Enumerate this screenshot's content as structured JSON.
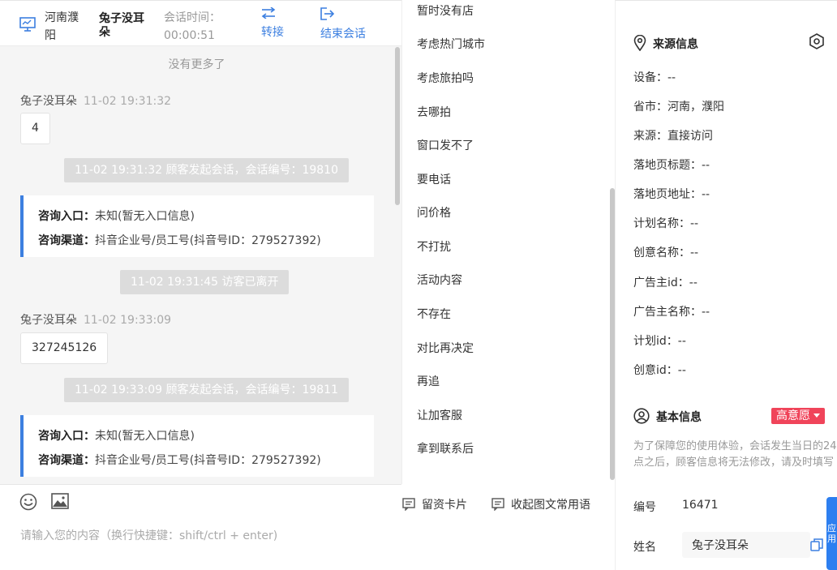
{
  "header": {
    "location": "河南濮阳",
    "customer_name": "兔子没耳朵",
    "session_time_label": "会话时间：",
    "session_time_value": "00:00:51",
    "transfer_label": "转接",
    "end_label": "结束会话"
  },
  "chat": {
    "no_more": "没有更多了",
    "messages": [
      {
        "sender": "兔子没耳朵",
        "time": "11-02 19:31:32",
        "content": "4"
      },
      {
        "system": "11-02 19:31:32 顾客发起会话，会话编号：19810"
      },
      {
        "entry_label": "咨询入口：",
        "entry_value": "未知(暂无入口信息)",
        "channel_label": "咨询渠道：",
        "channel_value": "抖音企业号/员工号(抖音号ID：279527392)"
      },
      {
        "system": "11-02 19:31:45 访客已离开"
      },
      {
        "sender": "兔子没耳朵",
        "time": "11-02 19:33:09",
        "content": "327245126"
      },
      {
        "system": "11-02 19:33:09 顾客发起会话，会话编号：19811"
      },
      {
        "entry_label": "咨询入口：",
        "entry_value": "未知(暂无入口信息)",
        "channel_label": "咨询渠道：",
        "channel_value": "抖音企业号/员工号(抖音号ID：279527392)"
      }
    ]
  },
  "composer": {
    "placeholder": "请输入您的内容（换行快捷键：shift/ctrl + enter)",
    "emoji_icon": "emoji-icon",
    "image_icon": "image-icon",
    "card_label": "留资卡片",
    "collapse_label": "收起图文常用语"
  },
  "phrases": [
    "暂时没有店",
    "考虑热门城市",
    "考虑旅拍吗",
    "去哪拍",
    "窗口发不了",
    "要电话",
    "问价格",
    "不打扰",
    "活动内容",
    "不存在",
    "对比再决定",
    "再追",
    "让加客服",
    "拿到联系后"
  ],
  "source": {
    "title": "来源信息",
    "fields": [
      {
        "label": "设备：",
        "value": "--"
      },
      {
        "label": "省市：",
        "value": "河南，濮阳"
      },
      {
        "label": "来源：",
        "value": "直接访问"
      },
      {
        "label": "落地页标题：",
        "value": "--"
      },
      {
        "label": "落地页地址：",
        "value": "--"
      },
      {
        "label": "计划名称：",
        "value": "--"
      },
      {
        "label": "创意名称：",
        "value": "--"
      },
      {
        "label": "广告主id：",
        "value": "--"
      },
      {
        "label": "广告主名称：",
        "value": "--"
      },
      {
        "label": "计划id：",
        "value": "--"
      },
      {
        "label": "创意id：",
        "value": "--"
      }
    ]
  },
  "basic": {
    "title": "基本信息",
    "badge": "高意愿",
    "notice": "为了保障您的使用体验，会话发生当日的24点之后，顾客信息将无法修改，请及时填写",
    "id_label": "编号",
    "id_value": "16471",
    "name_label": "姓名",
    "name_value": "兔子没耳朵"
  },
  "side_tab": "应用",
  "colors": {
    "accent": "#3c7fe0",
    "badge": "#f0445a",
    "tab": "#2d7ff0"
  }
}
